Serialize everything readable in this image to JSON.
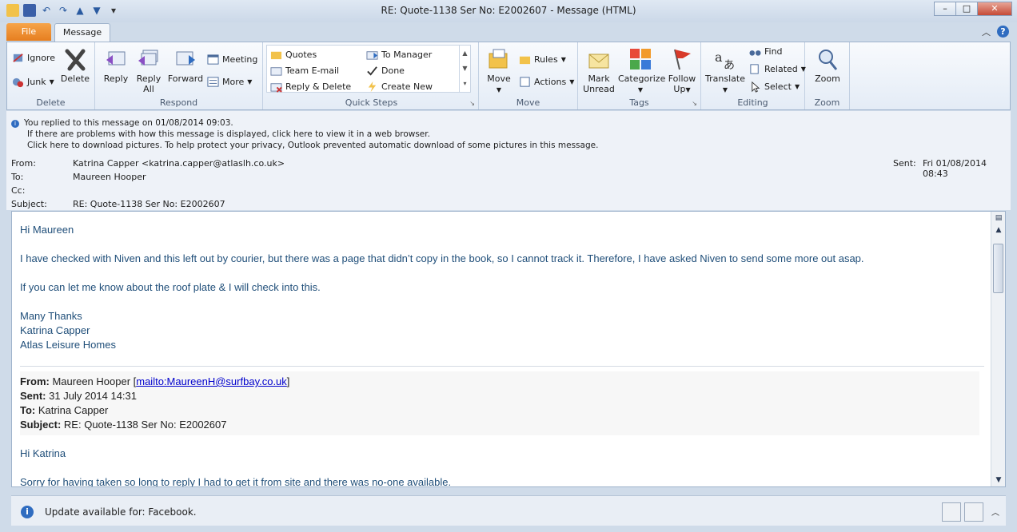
{
  "window": {
    "title": "RE: Quote-1138  Ser No:  E2002607  -  Message (HTML)"
  },
  "tabs": {
    "file": "File",
    "message": "Message"
  },
  "ribbon": {
    "delete": {
      "ignore": "Ignore",
      "junk": "Junk",
      "delete": "Delete",
      "label": "Delete"
    },
    "respond": {
      "reply": "Reply",
      "reply_all_1": "Reply",
      "reply_all_2": "All",
      "forward": "Forward",
      "meeting": "Meeting",
      "more": "More",
      "label": "Respond"
    },
    "quicksteps": {
      "items": [
        "Quotes",
        "Team E-mail",
        "Reply & Delete",
        "To Manager",
        "Done",
        "Create New"
      ],
      "label": "Quick Steps"
    },
    "move": {
      "move": "Move",
      "rules": "Rules",
      "actions": "Actions",
      "label": "Move"
    },
    "tags": {
      "mark_1": "Mark",
      "mark_2": "Unread",
      "categorize": "Categorize",
      "follow_1": "Follow",
      "follow_2": "Up",
      "label": "Tags"
    },
    "editing": {
      "translate": "Translate",
      "find": "Find",
      "related": "Related",
      "select": "Select",
      "label": "Editing"
    },
    "zoom": {
      "zoom": "Zoom",
      "label": "Zoom"
    }
  },
  "info": {
    "line1": "You replied to this message on 01/08/2014 09:03.",
    "line2": "If there are problems with how this message is displayed, click here to view it in a web browser.",
    "line3": "Click here to download pictures. To help protect your privacy, Outlook prevented automatic download of some pictures in this message."
  },
  "header": {
    "from_label": "From:",
    "from": "Katrina Capper <katrina.capper@atlaslh.co.uk>",
    "to_label": "To:",
    "to": "Maureen Hooper",
    "cc_label": "Cc:",
    "subject_label": "Subject:",
    "subject": "RE: Quote-1138  Ser No:  E2002607",
    "sent_label": "Sent:",
    "sent": "Fri 01/08/2014 08:43"
  },
  "body": {
    "greeting": "Hi Maureen",
    "p1": "I have checked with Niven and this left out by courier, but there was a page that didn’t copy in the book, so I cannot track it.  Therefore, I have asked Niven to send some more out asap.",
    "p2": "If you can let me know about the roof plate & I will check into this.",
    "sig1": "Many Thanks",
    "sig2": "Katrina Capper",
    "sig3": "Atlas Leisure Homes",
    "q_from_label": "From:",
    "q_from": "Maureen Hooper [",
    "q_from_link": "mailto:MaureenH@surfbay.co.uk",
    "q_from_end": "]",
    "q_sent_label": "Sent:",
    "q_sent": "31 July 2014 14:31",
    "q_to_label": "To:",
    "q_to": "Katrina Capper",
    "q_subject_label": "Subject:",
    "q_subject": "RE: Quote-1138 Ser No: E2002607",
    "q_greeting": "Hi Katrina",
    "q_p1": "Sorry for having taken so long to reply I had to get it from site and there was no-one available."
  },
  "status": {
    "text": "Update available for: Facebook."
  }
}
